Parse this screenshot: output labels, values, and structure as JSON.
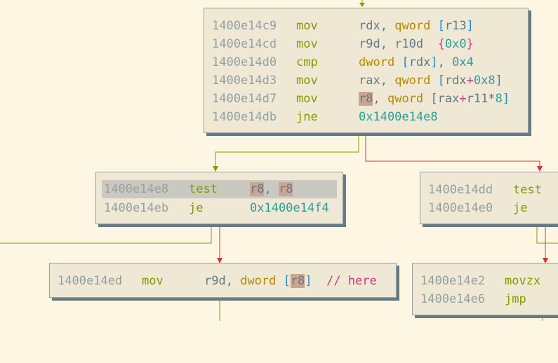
{
  "colors": {
    "background": "#fdf6e3",
    "block_fill": "#eee8d5",
    "edge_true": "#859900",
    "edge_false": "#dc322f",
    "register_highlight": "#c9a592"
  },
  "blocks": {
    "top": {
      "lines": [
        {
          "addr": "1400e14c9",
          "mnem": "mov",
          "ops": [
            "rdx",
            ", ",
            "qword",
            " ",
            "[",
            "r13",
            "]"
          ]
        },
        {
          "addr": "1400e14cd",
          "mnem": "mov",
          "ops": [
            "r9d",
            ", ",
            "r10d",
            "  ",
            "{",
            "0x0",
            "}"
          ]
        },
        {
          "addr": "1400e14d0",
          "mnem": "cmp",
          "ops": [
            "dword",
            " ",
            "[",
            "rdx",
            "]",
            ", ",
            "0x4"
          ]
        },
        {
          "addr": "1400e14d3",
          "mnem": "mov",
          "ops": [
            "rax",
            ", ",
            "qword",
            " ",
            "[",
            "rdx",
            "+",
            "0x8",
            "]"
          ]
        },
        {
          "addr": "1400e14d7",
          "mnem": "mov",
          "ops": [
            "r8",
            ", ",
            "qword",
            " ",
            "[",
            "rax",
            "+",
            "r11",
            "*",
            "8",
            "]"
          ]
        },
        {
          "addr": "1400e14db",
          "mnem": "jne",
          "ops": [
            "0x1400e14e8"
          ]
        }
      ]
    },
    "mid_left": {
      "lines": [
        {
          "addr": "1400e14e8",
          "mnem": "test",
          "ops": [
            "r8",
            ", ",
            "r8"
          ]
        },
        {
          "addr": "1400e14eb",
          "mnem": "je",
          "ops": [
            "0x1400e14f4"
          ]
        }
      ]
    },
    "mid_right": {
      "lines": [
        {
          "addr": "1400e14dd",
          "mnem": "test"
        },
        {
          "addr": "1400e14e0",
          "mnem": "je"
        }
      ]
    },
    "bottom_left": {
      "lines": [
        {
          "addr": "1400e14ed",
          "mnem": "mov",
          "ops": [
            "r9d",
            ", ",
            "dword",
            " ",
            "[",
            "r8",
            "]",
            "  ",
            "// here"
          ]
        }
      ]
    },
    "bottom_right": {
      "lines": [
        {
          "addr": "1400e14e2",
          "mnem": "movzx"
        },
        {
          "addr": "1400e14e6",
          "mnem": "jmp"
        }
      ]
    }
  }
}
